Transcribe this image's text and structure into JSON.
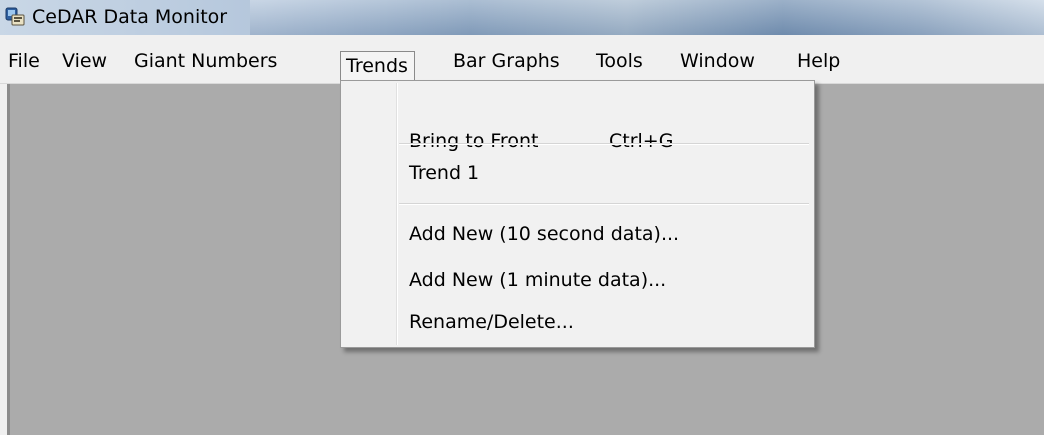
{
  "window": {
    "title": "CeDAR Data Monitor",
    "icon": "app-icon"
  },
  "menubar": {
    "items": [
      {
        "label": "File"
      },
      {
        "label": "View"
      },
      {
        "label": "Giant Numbers"
      },
      {
        "label": "Trends",
        "open": true
      },
      {
        "label": "Bar Graphs"
      },
      {
        "label": "Tools"
      },
      {
        "label": "Window"
      },
      {
        "label": "Help"
      }
    ]
  },
  "trends_menu": {
    "items": [
      {
        "label": "Bring to Front",
        "shortcut": "Ctrl+G"
      },
      {
        "label": "Trend 1"
      },
      {
        "label": "Add New (10 second data)..."
      },
      {
        "label": "Add New (1 minute data)..."
      },
      {
        "label": "Rename/Delete..."
      }
    ]
  },
  "colors": {
    "menubar_bg": "#f0f0f0",
    "client_bg": "#ababab",
    "dropdown_bg": "#f1f1f1"
  }
}
